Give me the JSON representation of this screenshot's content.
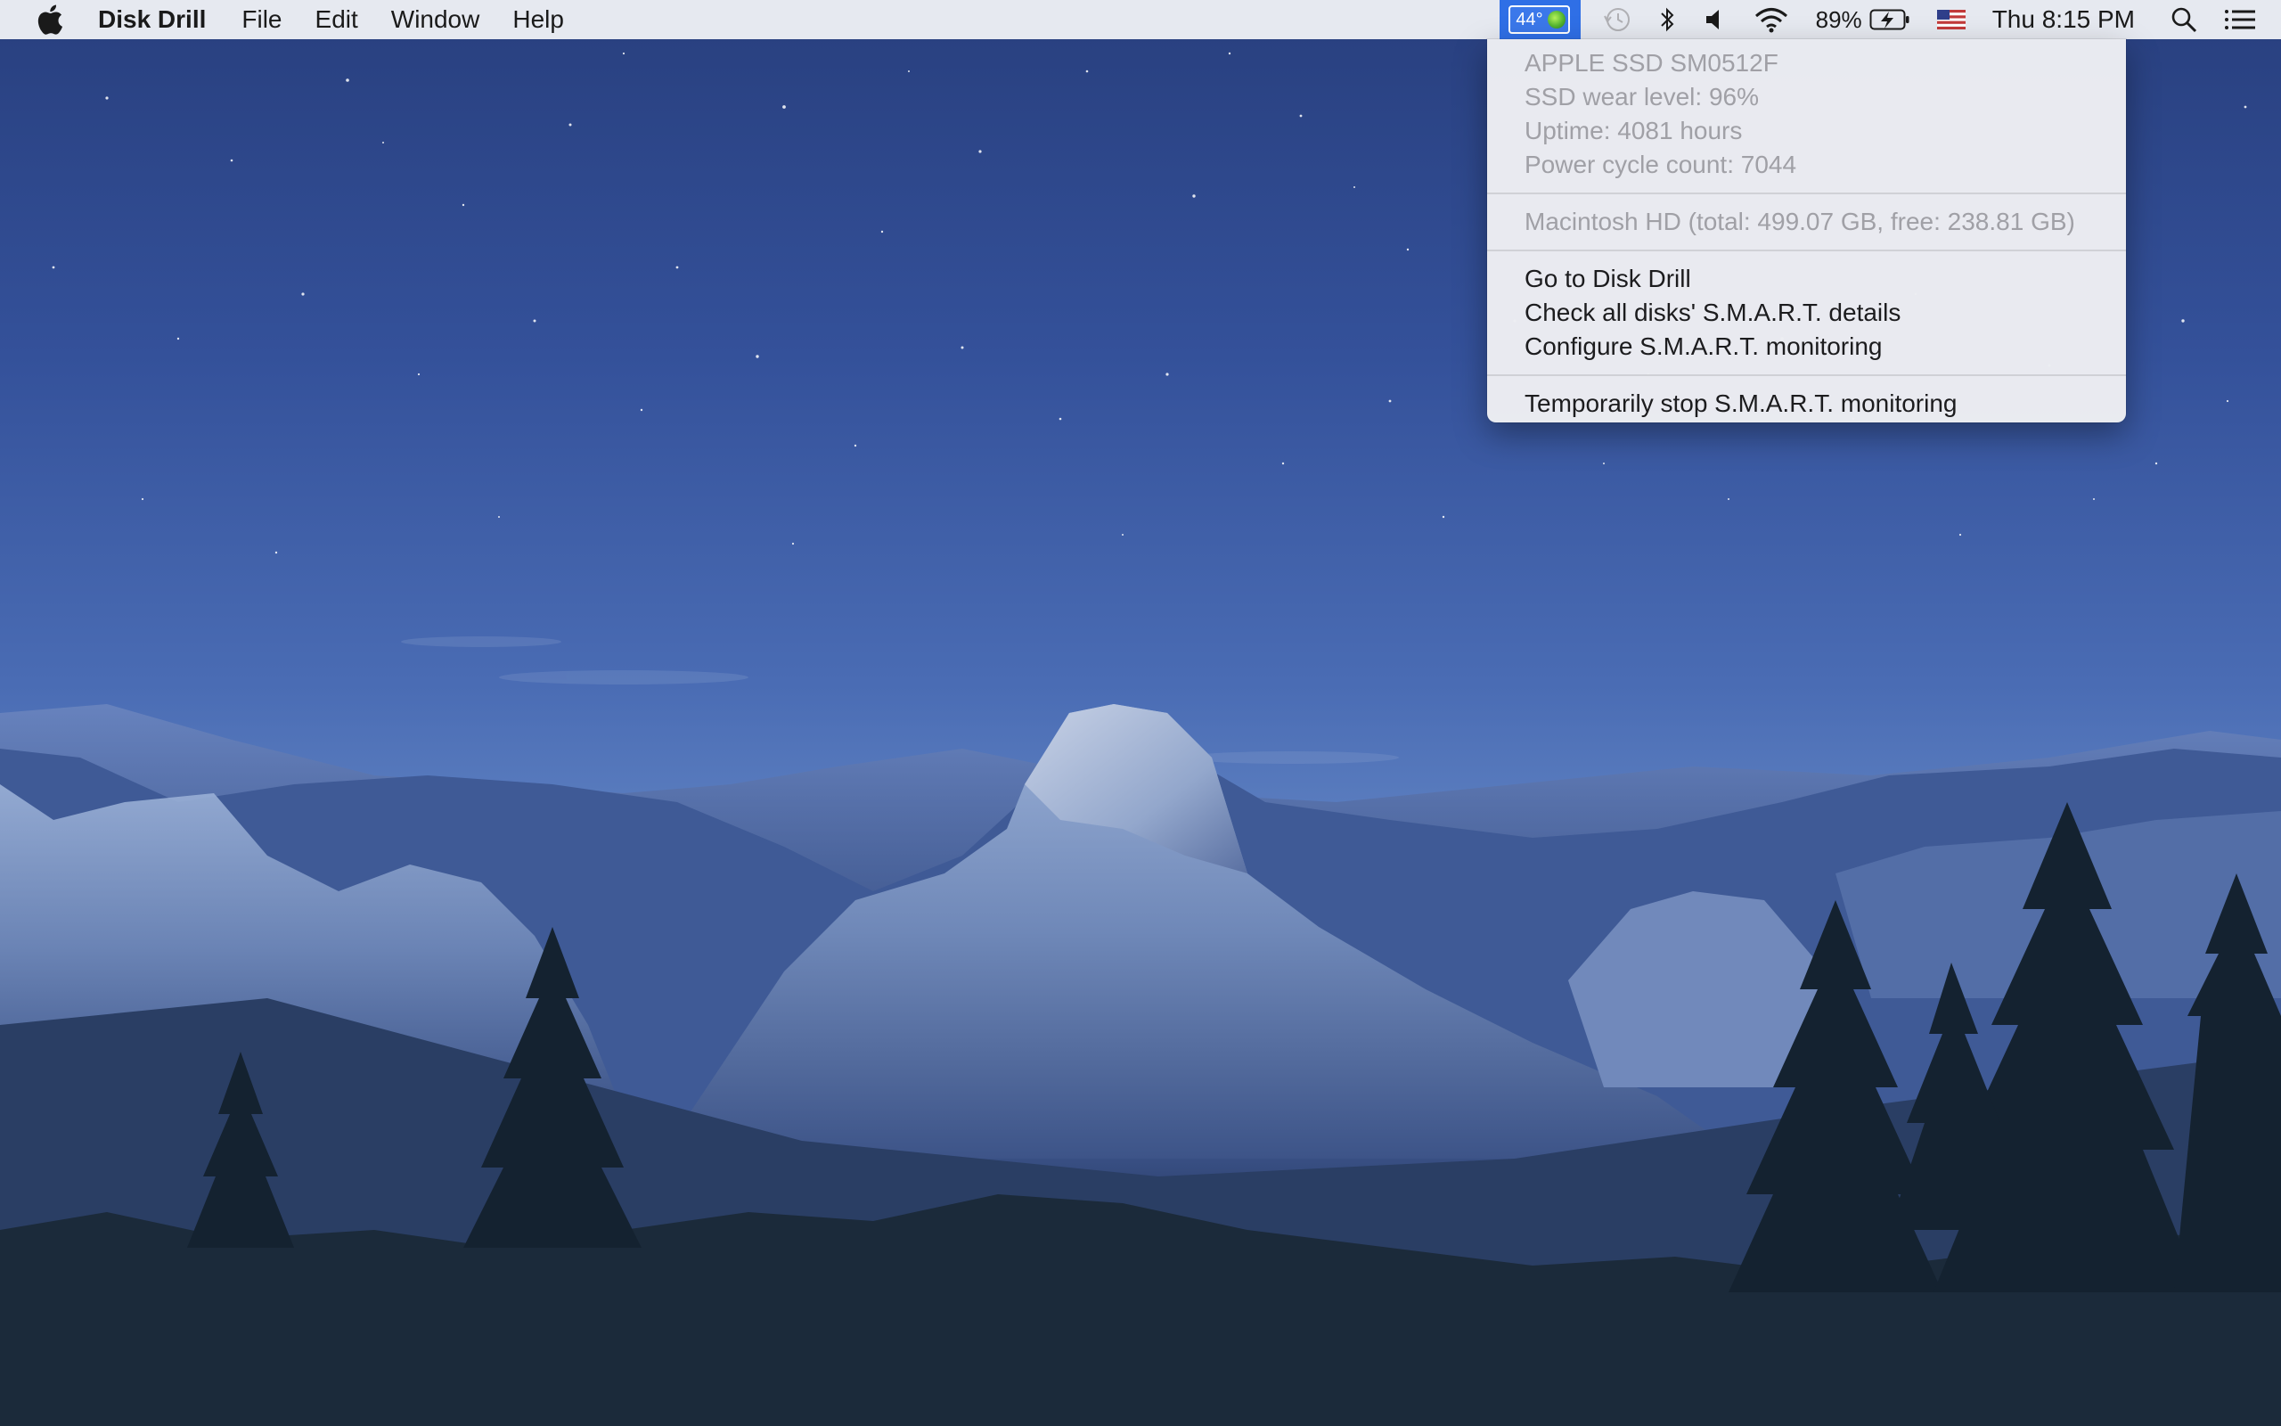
{
  "menubar": {
    "apple_icon": "apple-logo-icon",
    "app_name": "Disk Drill",
    "menus": [
      "File",
      "Edit",
      "Window",
      "Help"
    ],
    "status": {
      "temperature": "44°",
      "battery_percent": "89%",
      "clock": "Thu 8:15 PM",
      "icons": [
        "time-machine-icon",
        "bluetooth-icon",
        "volume-icon",
        "wifi-icon",
        "battery-charging-icon",
        "us-flag-icon",
        "spotlight-search-icon",
        "notification-center-icon"
      ]
    }
  },
  "dropdown": {
    "info": [
      "APPLE SSD SM0512F",
      "SSD wear level: 96%",
      "Uptime: 4081 hours",
      "Power cycle count: 7044"
    ],
    "volume": "Macintosh HD (total: 499.07 GB, free: 238.81 GB)",
    "actions": [
      "Go to Disk Drill",
      "Check all disks' S.M.A.R.T. details",
      "Configure S.M.A.R.T. monitoring"
    ],
    "stop": "Temporarily stop S.M.A.R.T. monitoring"
  },
  "colors": {
    "menubar_bg": "#eceef4",
    "highlight": "#2f6fe6",
    "disabled_text": "#a0a0a6",
    "sky_top": "#283f7e",
    "forest": "#1c2a3e"
  }
}
